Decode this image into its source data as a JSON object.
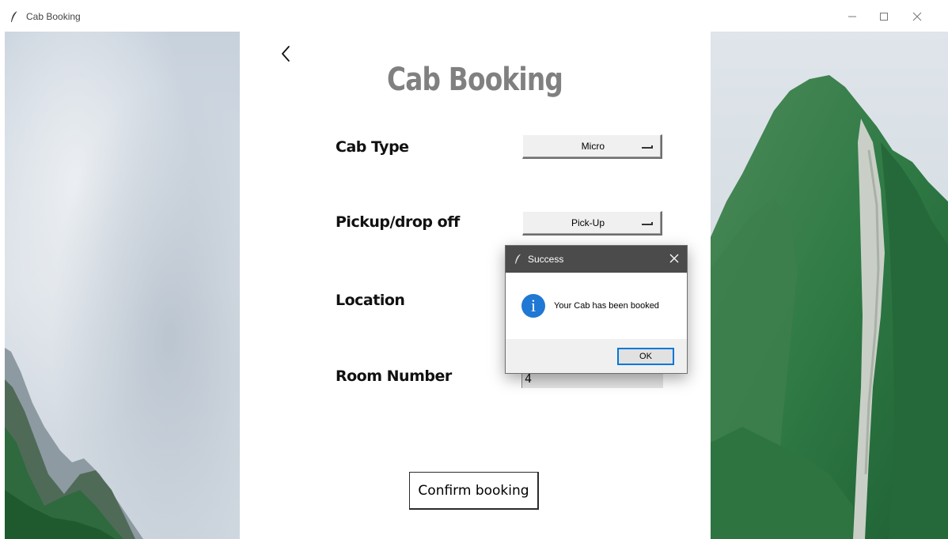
{
  "window": {
    "title": "Cab Booking",
    "icon": "feather-icon",
    "controls": [
      "minimize-icon",
      "maximize-icon",
      "close-icon"
    ]
  },
  "page": {
    "back_icon": "chevron-left-icon",
    "title": "Cab Booking",
    "title_color": "#808080"
  },
  "form": {
    "cab_type": {
      "label": "Cab Type",
      "value": "Micro"
    },
    "pickup_drop": {
      "label": "Pickup/drop off",
      "value": "Pick-Up"
    },
    "location": {
      "label": "Location"
    },
    "room_number": {
      "label": "Room Number",
      "value": "4"
    },
    "confirm_label": "Confirm booking"
  },
  "dialog": {
    "title": "Success",
    "message": "Your Cab has been booked",
    "ok_label": "OK",
    "icon": "info-icon",
    "accent_color": "#0078d7",
    "titlebar_color": "#4b4b4b"
  }
}
